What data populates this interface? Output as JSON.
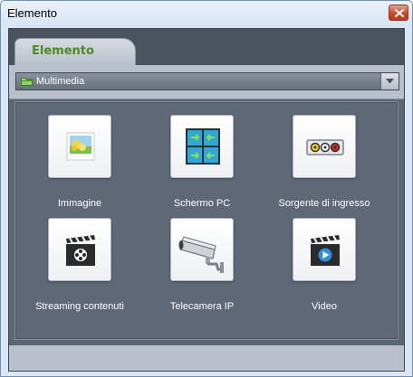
{
  "window": {
    "title": "Elemento",
    "close_icon": "close-icon",
    "close_color": "#c94b2c"
  },
  "tab": {
    "label": "Elemento",
    "color": "#4a8b1e"
  },
  "category_dropdown": {
    "selected": "Multimedia",
    "icon": "folder-icon"
  },
  "items": [
    {
      "label": "Immagine",
      "icon": "image-icon"
    },
    {
      "label": "Schermo PC",
      "icon": "pc-screen-icon"
    },
    {
      "label": "Sorgente di ingresso",
      "icon": "input-source-icon"
    },
    {
      "label": "Streaming contenuti",
      "icon": "streaming-icon"
    },
    {
      "label": "Telecamera IP",
      "icon": "ip-camera-icon"
    },
    {
      "label": "Video",
      "icon": "video-icon"
    }
  ]
}
